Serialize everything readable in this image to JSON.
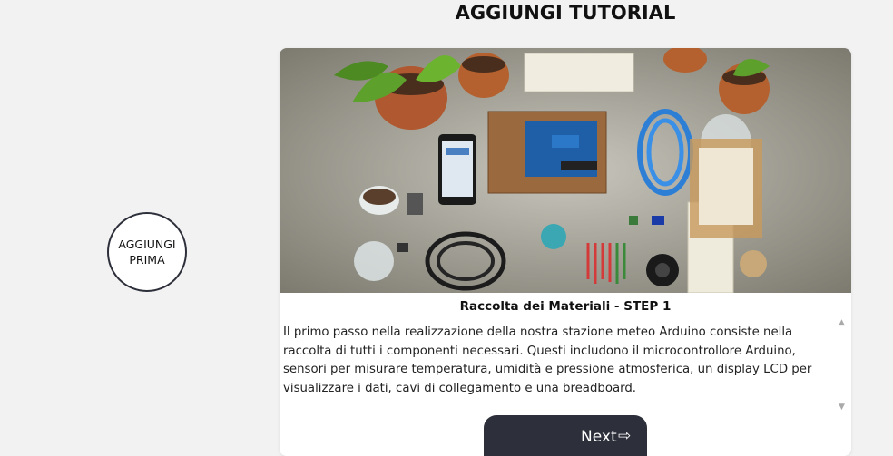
{
  "header": {
    "title": "AGGIUNGI TUTORIAL"
  },
  "sidebar": {
    "add_before_label": "AGGIUNGI PRIMA"
  },
  "step": {
    "title": "Raccolta dei Materiali - STEP 1",
    "description": "Il primo passo nella realizzazione della nostra stazione meteo Arduino consiste nella raccolta di tutti i componenti necessari. Questi includono il microcontrollore Arduino, sensori per misurare temperatura, umidità e pressione atmosferica, un display LCD per visualizzare i dati, cavi di collegamento e una breadboard.",
    "next_label": "Next",
    "next_icon": "⇨"
  },
  "icons": {
    "next": "arrow-right-icon",
    "scroll": "chevron-icon"
  },
  "colors": {
    "button_bg": "#2d2f3a",
    "page_bg": "#f2f2f2",
    "card_bg": "#ffffff"
  }
}
